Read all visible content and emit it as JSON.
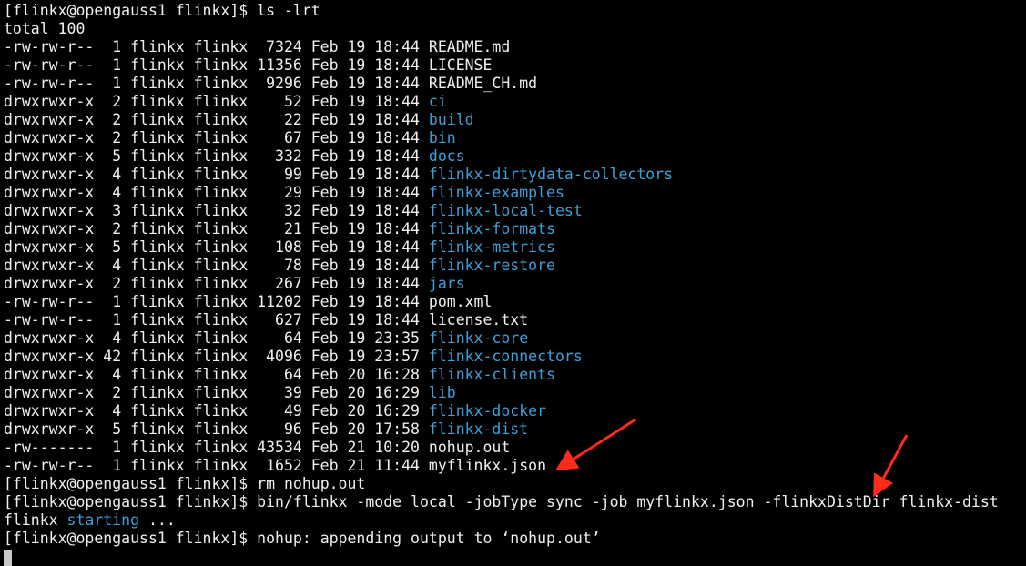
{
  "prompt": "[flinkx@opengauss1 flinkx]$",
  "commands": {
    "ls": "ls -lrt",
    "rm": "rm nohup.out",
    "run": "bin/flinkx -mode local -jobType sync -job myflinkx.json -flinkxDistDir flinkx-dist"
  },
  "total": "total 100",
  "entries": [
    {
      "perms": "-rw-rw-r--",
      "links": "1",
      "owner": "flinkx",
      "group": "flinkx",
      "size": "7324",
      "month": "Feb",
      "day": "19",
      "time": "18:44",
      "name": "README.md",
      "is_dir": false
    },
    {
      "perms": "-rw-rw-r--",
      "links": "1",
      "owner": "flinkx",
      "group": "flinkx",
      "size": "11356",
      "month": "Feb",
      "day": "19",
      "time": "18:44",
      "name": "LICENSE",
      "is_dir": false
    },
    {
      "perms": "-rw-rw-r--",
      "links": "1",
      "owner": "flinkx",
      "group": "flinkx",
      "size": "9296",
      "month": "Feb",
      "day": "19",
      "time": "18:44",
      "name": "README_CH.md",
      "is_dir": false
    },
    {
      "perms": "drwxrwxr-x",
      "links": "2",
      "owner": "flinkx",
      "group": "flinkx",
      "size": "52",
      "month": "Feb",
      "day": "19",
      "time": "18:44",
      "name": "ci",
      "is_dir": true
    },
    {
      "perms": "drwxrwxr-x",
      "links": "2",
      "owner": "flinkx",
      "group": "flinkx",
      "size": "22",
      "month": "Feb",
      "day": "19",
      "time": "18:44",
      "name": "build",
      "is_dir": true
    },
    {
      "perms": "drwxrwxr-x",
      "links": "2",
      "owner": "flinkx",
      "group": "flinkx",
      "size": "67",
      "month": "Feb",
      "day": "19",
      "time": "18:44",
      "name": "bin",
      "is_dir": true
    },
    {
      "perms": "drwxrwxr-x",
      "links": "5",
      "owner": "flinkx",
      "group": "flinkx",
      "size": "332",
      "month": "Feb",
      "day": "19",
      "time": "18:44",
      "name": "docs",
      "is_dir": true
    },
    {
      "perms": "drwxrwxr-x",
      "links": "4",
      "owner": "flinkx",
      "group": "flinkx",
      "size": "99",
      "month": "Feb",
      "day": "19",
      "time": "18:44",
      "name": "flinkx-dirtydata-collectors",
      "is_dir": true
    },
    {
      "perms": "drwxrwxr-x",
      "links": "4",
      "owner": "flinkx",
      "group": "flinkx",
      "size": "29",
      "month": "Feb",
      "day": "19",
      "time": "18:44",
      "name": "flinkx-examples",
      "is_dir": true
    },
    {
      "perms": "drwxrwxr-x",
      "links": "3",
      "owner": "flinkx",
      "group": "flinkx",
      "size": "32",
      "month": "Feb",
      "day": "19",
      "time": "18:44",
      "name": "flinkx-local-test",
      "is_dir": true
    },
    {
      "perms": "drwxrwxr-x",
      "links": "2",
      "owner": "flinkx",
      "group": "flinkx",
      "size": "21",
      "month": "Feb",
      "day": "19",
      "time": "18:44",
      "name": "flinkx-formats",
      "is_dir": true
    },
    {
      "perms": "drwxrwxr-x",
      "links": "5",
      "owner": "flinkx",
      "group": "flinkx",
      "size": "108",
      "month": "Feb",
      "day": "19",
      "time": "18:44",
      "name": "flinkx-metrics",
      "is_dir": true
    },
    {
      "perms": "drwxrwxr-x",
      "links": "4",
      "owner": "flinkx",
      "group": "flinkx",
      "size": "78",
      "month": "Feb",
      "day": "19",
      "time": "18:44",
      "name": "flinkx-restore",
      "is_dir": true
    },
    {
      "perms": "drwxrwxr-x",
      "links": "2",
      "owner": "flinkx",
      "group": "flinkx",
      "size": "267",
      "month": "Feb",
      "day": "19",
      "time": "18:44",
      "name": "jars",
      "is_dir": true
    },
    {
      "perms": "-rw-rw-r--",
      "links": "1",
      "owner": "flinkx",
      "group": "flinkx",
      "size": "11202",
      "month": "Feb",
      "day": "19",
      "time": "18:44",
      "name": "pom.xml",
      "is_dir": false
    },
    {
      "perms": "-rw-rw-r--",
      "links": "1",
      "owner": "flinkx",
      "group": "flinkx",
      "size": "627",
      "month": "Feb",
      "day": "19",
      "time": "18:44",
      "name": "license.txt",
      "is_dir": false
    },
    {
      "perms": "drwxrwxr-x",
      "links": "4",
      "owner": "flinkx",
      "group": "flinkx",
      "size": "64",
      "month": "Feb",
      "day": "19",
      "time": "23:35",
      "name": "flinkx-core",
      "is_dir": true
    },
    {
      "perms": "drwxrwxr-x",
      "links": "42",
      "owner": "flinkx",
      "group": "flinkx",
      "size": "4096",
      "month": "Feb",
      "day": "19",
      "time": "23:57",
      "name": "flinkx-connectors",
      "is_dir": true
    },
    {
      "perms": "drwxrwxr-x",
      "links": "4",
      "owner": "flinkx",
      "group": "flinkx",
      "size": "64",
      "month": "Feb",
      "day": "20",
      "time": "16:28",
      "name": "flinkx-clients",
      "is_dir": true
    },
    {
      "perms": "drwxrwxr-x",
      "links": "2",
      "owner": "flinkx",
      "group": "flinkx",
      "size": "39",
      "month": "Feb",
      "day": "20",
      "time": "16:29",
      "name": "lib",
      "is_dir": true
    },
    {
      "perms": "drwxrwxr-x",
      "links": "4",
      "owner": "flinkx",
      "group": "flinkx",
      "size": "49",
      "month": "Feb",
      "day": "20",
      "time": "16:29",
      "name": "flinkx-docker",
      "is_dir": true
    },
    {
      "perms": "drwxrwxr-x",
      "links": "5",
      "owner": "flinkx",
      "group": "flinkx",
      "size": "96",
      "month": "Feb",
      "day": "20",
      "time": "17:58",
      "name": "flinkx-dist",
      "is_dir": true
    },
    {
      "perms": "-rw-------",
      "links": "1",
      "owner": "flinkx",
      "group": "flinkx",
      "size": "43534",
      "month": "Feb",
      "day": "21",
      "time": "10:20",
      "name": "nohup.out",
      "is_dir": false
    },
    {
      "perms": "-rw-rw-r--",
      "links": "1",
      "owner": "flinkx",
      "group": "flinkx",
      "size": "1652",
      "month": "Feb",
      "day": "21",
      "time": "11:44",
      "name": "myflinkx.json",
      "is_dir": false
    }
  ],
  "starting": {
    "prefix": "flinkx",
    "word": "starting",
    "suffix": "..."
  },
  "nohup_message": "nohup: appending output to ‘nohup.out’",
  "colors": {
    "background": "#000000",
    "text": "#f0f0f0",
    "directory": "#3f9fd8",
    "arrow": "#ff2a1a"
  }
}
